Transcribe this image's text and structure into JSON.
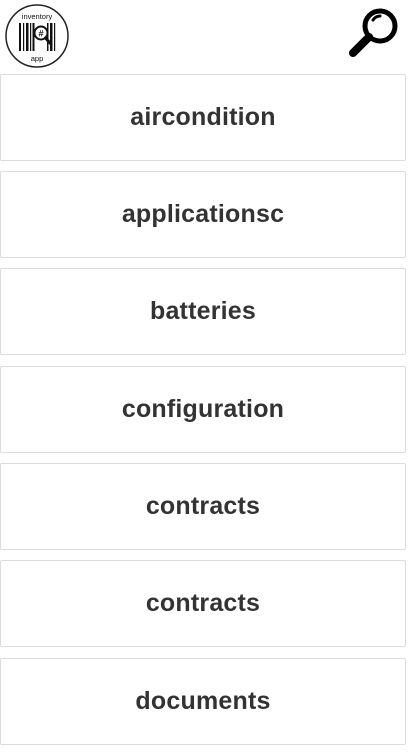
{
  "header": {
    "logo_top_text": "inventory",
    "logo_bottom_text": "app",
    "logo_icon": "barcode-magnifier-logo",
    "search_icon": "search-icon"
  },
  "items": [
    {
      "label": "aircondition"
    },
    {
      "label": "applicationsc"
    },
    {
      "label": "batteries"
    },
    {
      "label": "configuration"
    },
    {
      "label": "contracts"
    },
    {
      "label": "contracts"
    },
    {
      "label": "documents"
    }
  ]
}
